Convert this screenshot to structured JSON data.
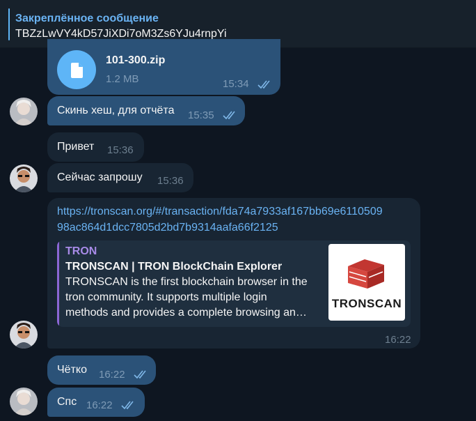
{
  "pinned": {
    "title": "Закреплённое сообщение",
    "text": "TBZzLwVY4kD57JiXDi7oM3Zs6YJu4rnpYi"
  },
  "messages": {
    "file": {
      "name": "101-300.zip",
      "size": "1.2 MB",
      "time": "15:34"
    },
    "hash_request": {
      "text": "Скинь хеш, для отчёта",
      "time": "15:35"
    },
    "hello": {
      "text": "Привет",
      "time": "15:36"
    },
    "will_request": {
      "text": "Сейчас запрошу",
      "time": "15:36"
    },
    "link": {
      "url_line1": "https://tronscan.org/#/transaction/fda74a7933af167bb69e6110509",
      "url_line2": "98ac864d1dcc7805d2bd7b9314aafa66f2125",
      "site": "TRON",
      "title": "TRONSCAN | TRON BlockChain Explorer",
      "desc_line1": "TRONSCAN is the first blockchain browser in the",
      "desc_line2": "tron community. It supports multiple login",
      "desc_line3": "methods and provides a complete browsing an…",
      "logo_text": "TRONSCAN",
      "time": "16:22"
    },
    "clear": {
      "text": "Чётко",
      "time": "16:22"
    },
    "thanks": {
      "text": "Спс",
      "time": "16:22"
    }
  },
  "colors": {
    "background": "#0e1621",
    "outgoing_bubble": "#2b5278",
    "incoming_bubble": "#182533",
    "accent": "#6ab3f3",
    "preview_accent": "#8c66d6"
  }
}
